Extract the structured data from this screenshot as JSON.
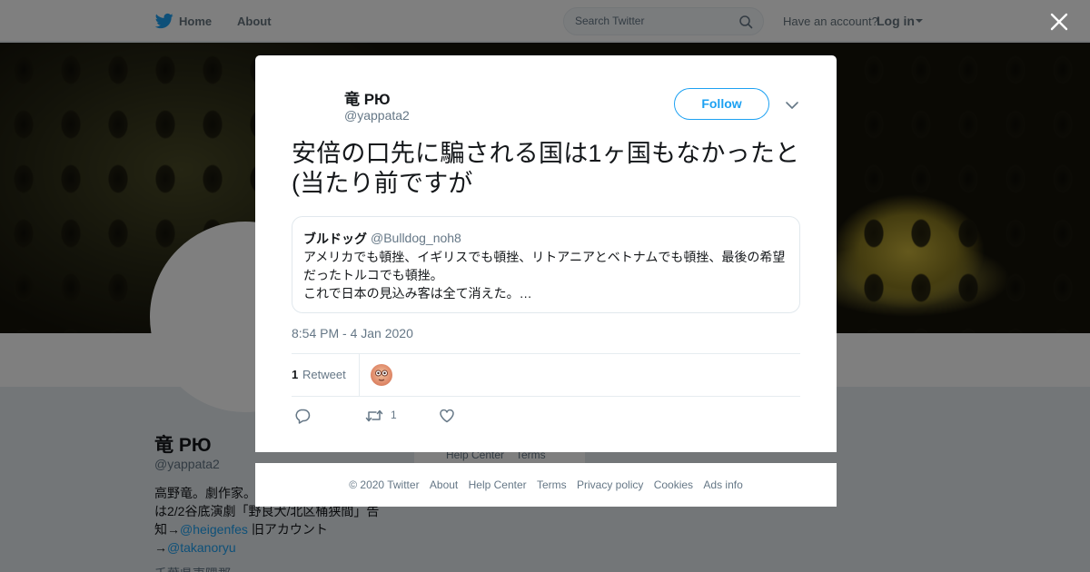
{
  "nav": {
    "home_label": "Home",
    "about_label": "About",
    "search_placeholder": "Search Twitter",
    "have_account": "Have an account?",
    "login_label": "Log in"
  },
  "background_profile": {
    "name": "竜 PЮ",
    "handle": "@yappata2",
    "bio_line1": "高野竜。劇作家。",
    "bio_line2": "は2/2谷底演劇「野良犬/北区桶狭間」告",
    "bio_line3_prefix": "知→",
    "bio_mention1": "@heigenfes",
    "bio_line3_suffix": " 旧アカウント",
    "bio_line4_prefix": "→",
    "bio_mention2": "@takanoryu",
    "location": "千葉県夷隅郡",
    "side_help": "Help Center",
    "side_terms": "Terms"
  },
  "tweet": {
    "author_name": "竜 PЮ",
    "author_handle": "@yappata2",
    "follow_label": "Follow",
    "text": "安倍の口先に騙される国は1ヶ国もなかったと(当たり前ですが",
    "quote": {
      "name": "ブルドッグ",
      "handle": "@Bulldog_noh8",
      "body_line1": "アメリカでも頓挫、イギリスでも頓挫、リトアニアとベトナムでも頓挫、最後の希望",
      "body_line2": "だったトルコでも頓挫。",
      "body_line3": "これで日本の見込み客は全て消えた。…"
    },
    "timestamp": "8:54 PM - 4 Jan 2020",
    "retweet_count": "1",
    "retweet_label": "Retweet",
    "action_retweet_count": "1"
  },
  "footer": {
    "copyright": "© 2020 Twitter",
    "about": "About",
    "help_center": "Help Center",
    "terms": "Terms",
    "privacy": "Privacy policy",
    "cookies": "Cookies",
    "ads_info": "Ads info"
  },
  "colors": {
    "accent": "#1da1f2",
    "text": "#14171a",
    "muted": "#657786"
  }
}
